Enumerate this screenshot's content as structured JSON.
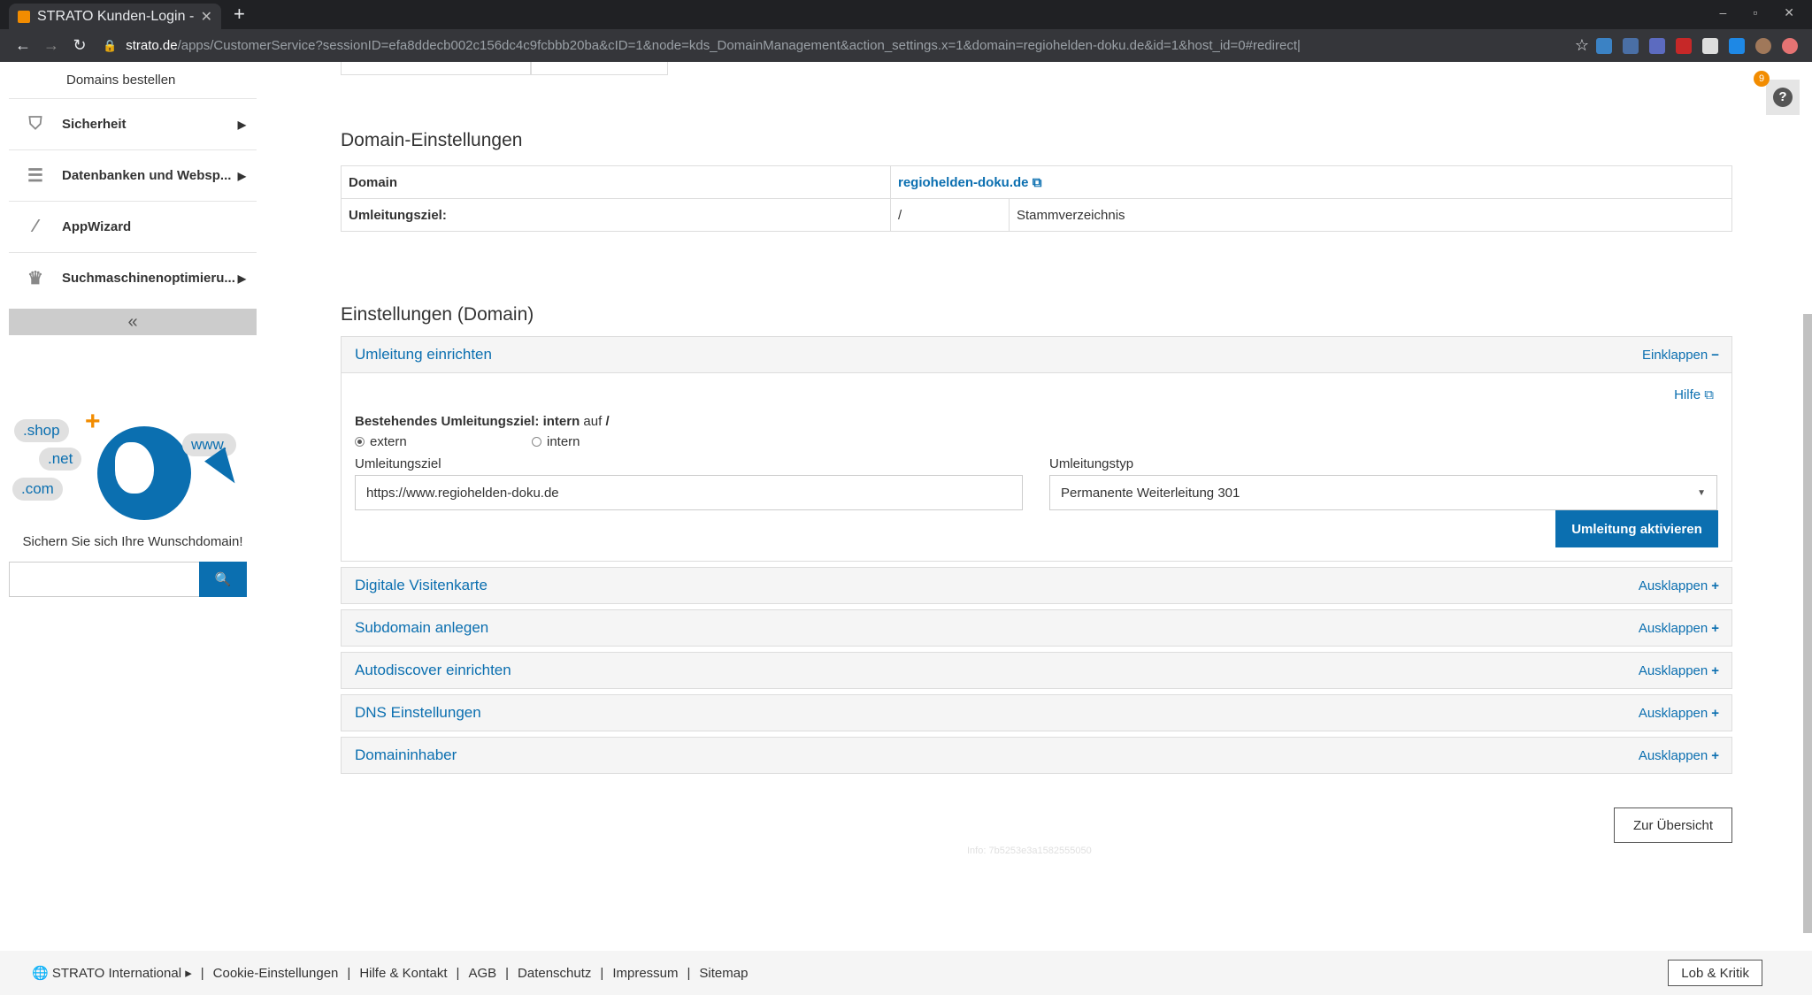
{
  "browser": {
    "tab_title": "STRATO Kunden-Login - D",
    "url_host": "strato.de",
    "url_path": "/apps/CustomerService?sessionID=efa8ddecb002c156dc4c9fcbbb20ba&cID=1&node=kds_DomainManagement&action_settings.x=1&domain=regiohelden-doku.de&id=1&host_id=0#redirect|"
  },
  "sidebar": {
    "sub_item": "Domains bestellen",
    "items": [
      {
        "label": "Sicherheit",
        "icon": "shield-icon"
      },
      {
        "label": "Datenbanken und Websp...",
        "icon": "database-icon"
      },
      {
        "label": "AppWizard",
        "icon": "wand-icon"
      },
      {
        "label": "Suchmaschinenoptimieru...",
        "icon": "trophy-icon"
      }
    ],
    "collapse_glyph": "«"
  },
  "promo": {
    "shop": ".shop",
    "net": ".net",
    "com": ".com",
    "www": "www.",
    "text": "Sichern Sie sich Ihre Wunschdomain!"
  },
  "domain_settings": {
    "title": "Domain-Einstellungen",
    "domain_label": "Domain",
    "domain_value": "regiohelden-doku.de",
    "target_label": "Umleitungsziel:",
    "target_path": "/",
    "target_desc": "Stammverzeichnis"
  },
  "settings": {
    "title": "Einstellungen (Domain)",
    "redirect_panel": {
      "title": "Umleitung einrichten",
      "toggle": "Einklappen",
      "help": "Hilfe",
      "existing_prefix": "Bestehendes Umleitungsziel:",
      "existing_type": "intern",
      "existing_mid": "auf",
      "existing_path": "/",
      "radio_extern": "extern",
      "radio_intern": "intern",
      "target_label": "Umleitungsziel",
      "target_value": "https://www.regiohelden-doku.de",
      "type_label": "Umleitungstyp",
      "type_value": "Permanente Weiterleitung 301",
      "button": "Umleitung aktivieren"
    },
    "panels": [
      {
        "title": "Digitale Visitenkarte",
        "toggle": "Ausklappen"
      },
      {
        "title": "Subdomain anlegen",
        "toggle": "Ausklappen"
      },
      {
        "title": "Autodiscover einrichten",
        "toggle": "Ausklappen"
      },
      {
        "title": "DNS Einstellungen",
        "toggle": "Ausklappen"
      },
      {
        "title": "Domaininhaber",
        "toggle": "Ausklappen"
      }
    ]
  },
  "overview_button": "Zur Übersicht",
  "info_text": "Info: 7b5253e3a1582555050",
  "help_badge": "9",
  "footer": {
    "international": "STRATO International ▸",
    "links": [
      "Cookie-Einstellungen",
      "Hilfe & Kontakt",
      "AGB",
      "Datenschutz",
      "Impressum",
      "Sitemap"
    ],
    "feedback": "Lob & Kritik"
  }
}
